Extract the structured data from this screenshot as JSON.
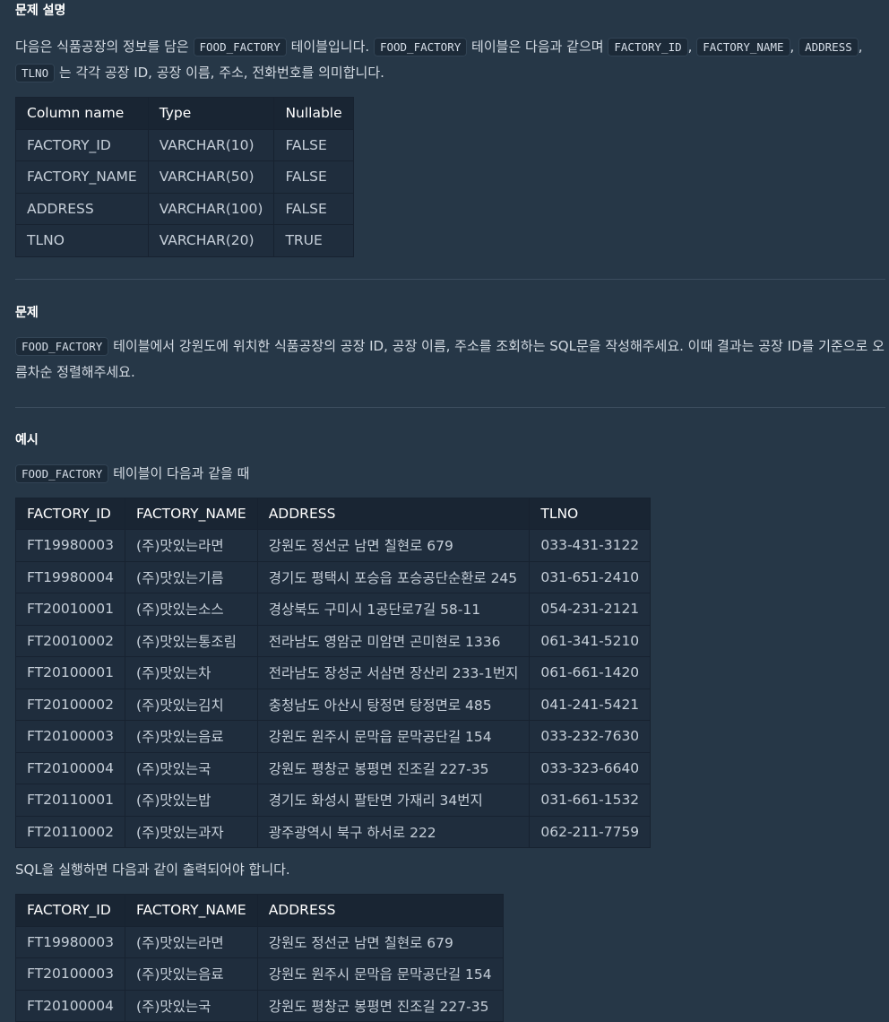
{
  "desc": {
    "title": "문제 설명",
    "p1": "다음은 식품공장의 정보를 담은",
    "p2": "테이블입니다.",
    "p3": "테이블은 다음과 같으며",
    "p4": "는 각각 공장 ID, 공장 이름, 주소, 전화번호를 의미합니다.",
    "code_table": "FOOD_FACTORY",
    "code_c1": "FACTORY_ID",
    "code_c2": "FACTORY_NAME",
    "code_c3": "ADDRESS",
    "code_c4": "TLNO",
    "comma": ",",
    "schema": {
      "headers": [
        "Column name",
        "Type",
        "Nullable"
      ],
      "rows": [
        [
          "FACTORY_ID",
          "VARCHAR(10)",
          "FALSE"
        ],
        [
          "FACTORY_NAME",
          "VARCHAR(50)",
          "FALSE"
        ],
        [
          "ADDRESS",
          "VARCHAR(100)",
          "FALSE"
        ],
        [
          "TLNO",
          "VARCHAR(20)",
          "TRUE"
        ]
      ]
    }
  },
  "problem": {
    "title": "문제",
    "code": "FOOD_FACTORY",
    "text": "테이블에서 강원도에 위치한 식품공장의 공장 ID, 공장 이름, 주소를 조회하는 SQL문을 작성해주세요. 이때 결과는 공장 ID를 기준으로 오름차순 정렬해주세요."
  },
  "example": {
    "title": "예시",
    "code": "FOOD_FACTORY",
    "intro": "테이블이 다음과 같을 때",
    "input": {
      "headers": [
        "FACTORY_ID",
        "FACTORY_NAME",
        "ADDRESS",
        "TLNO"
      ],
      "rows": [
        [
          "FT19980003",
          "(주)맛있는라면",
          "강원도 정선군 남면 칠현로 679",
          "033-431-3122"
        ],
        [
          "FT19980004",
          "(주)맛있는기름",
          "경기도 평택시 포승읍 포승공단순환로 245",
          "031-651-2410"
        ],
        [
          "FT20010001",
          "(주)맛있는소스",
          "경상북도 구미시 1공단로7길 58-11",
          "054-231-2121"
        ],
        [
          "FT20010002",
          "(주)맛있는통조림",
          "전라남도 영암군 미암면 곤미현로 1336",
          "061-341-5210"
        ],
        [
          "FT20100001",
          "(주)맛있는차",
          "전라남도 장성군 서삼면 장산리 233-1번지",
          "061-661-1420"
        ],
        [
          "FT20100002",
          "(주)맛있는김치",
          "충청남도 아산시 탕정면 탕정면로 485",
          "041-241-5421"
        ],
        [
          "FT20100003",
          "(주)맛있는음료",
          "강원도 원주시 문막읍 문막공단길 154",
          "033-232-7630"
        ],
        [
          "FT20100004",
          "(주)맛있는국",
          "강원도 평창군 봉평면 진조길 227-35",
          "033-323-6640"
        ],
        [
          "FT20110001",
          "(주)맛있는밥",
          "경기도 화성시 팔탄면 가재리 34번지",
          "031-661-1532"
        ],
        [
          "FT20110002",
          "(주)맛있는과자",
          "광주광역시 북구 하서로 222",
          "062-211-7759"
        ]
      ]
    },
    "result_intro": "SQL을 실행하면 다음과 같이 출력되어야 합니다.",
    "output": {
      "headers": [
        "FACTORY_ID",
        "FACTORY_NAME",
        "ADDRESS"
      ],
      "rows": [
        [
          "FT19980003",
          "(주)맛있는라면",
          "강원도 정선군 남면 칠현로 679"
        ],
        [
          "FT20100003",
          "(주)맛있는음료",
          "강원도 원주시 문막읍 문막공단길 154"
        ],
        [
          "FT20100004",
          "(주)맛있는국",
          "강원도 평창군 봉평면 진조길 227-35"
        ]
      ]
    }
  }
}
